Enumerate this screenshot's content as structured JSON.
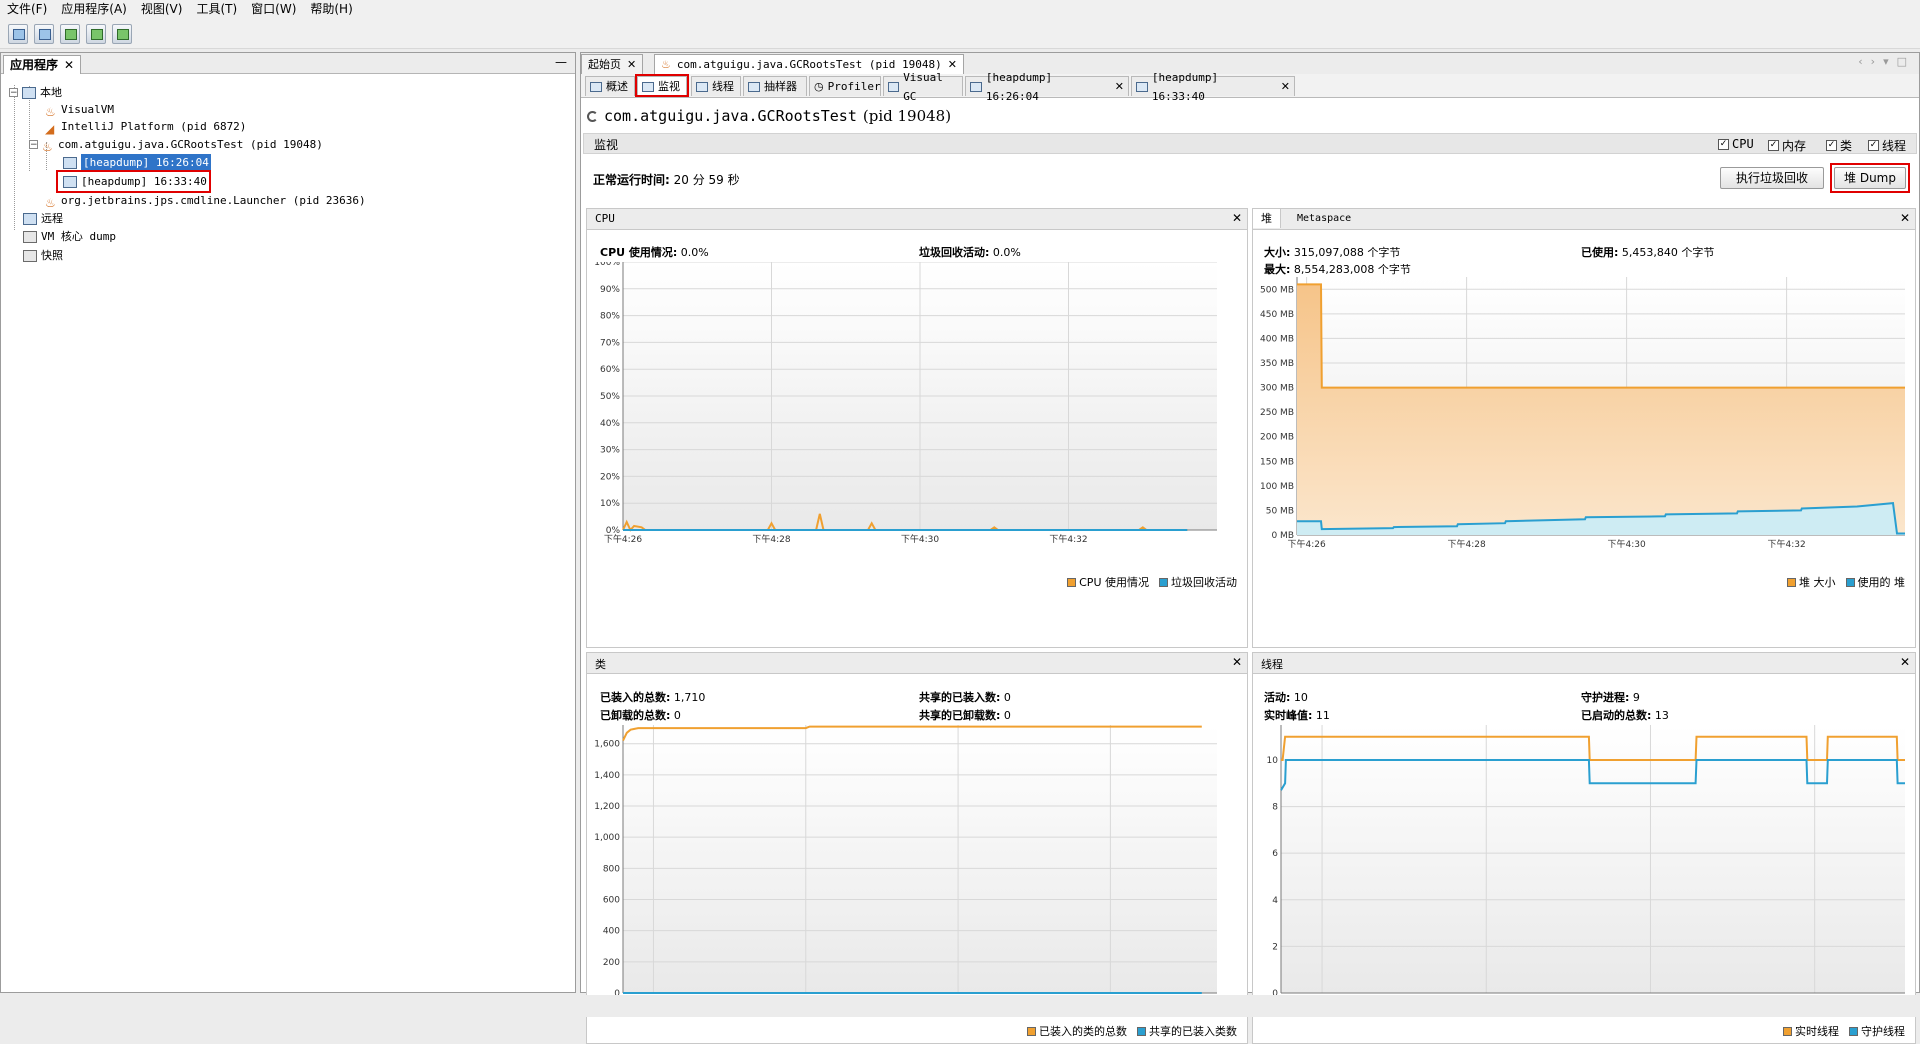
{
  "menu": [
    "文件(F)",
    "应用程序(A)",
    "视图(V)",
    "工具(T)",
    "窗口(W)",
    "帮助(H)"
  ],
  "left_panel": {
    "tab_label": "应用程序",
    "tree": {
      "local": "本地",
      "visualvm": "VisualVM",
      "intellij": "IntelliJ Platform (pid 6872)",
      "gcroots": "com.atguigu.java.GCRootsTest (pid 19048)",
      "heapdump1": "[heapdump] 16:26:04",
      "heapdump2": "[heapdump] 16:33:40",
      "launcher": "org.jetbrains.jps.cmdline.Launcher (pid 23636)",
      "remote": "远程",
      "coredump": "VM 核心 dump",
      "snapshot": "快照"
    }
  },
  "doc_tabs": {
    "start": "起始页",
    "app": "com.atguigu.java.GCRootsTest (pid 19048)"
  },
  "sub_tabs": {
    "overview": "概述",
    "monitor": "监视",
    "threads": "线程",
    "sampler": "抽样器",
    "profiler": "Profiler",
    "visualgc": "Visual GC",
    "hd1": "[heapdump] 16:26:04",
    "hd2": "[heapdump] 16:33:40"
  },
  "app_title": {
    "name": "com.atguigu.java.GCRootsTest",
    "pid": "(pid 19048)"
  },
  "monitor": {
    "label": "监视",
    "checks": [
      "CPU",
      "内存",
      "类",
      "线程"
    ],
    "uptime_label": "正常运行时间:",
    "uptime_value": "20 分 59 秒",
    "gc_button": "执行垃圾回收",
    "dump_button": "堆 Dump"
  },
  "cpu_panel": {
    "title": "CPU",
    "cpu_usage_label": "CPU 使用情况:",
    "cpu_usage_value": "0.0%",
    "gc_activity_label": "垃圾回收活动:",
    "gc_activity_value": "0.0%",
    "legend": [
      "CPU 使用情况",
      "垃圾回收活动"
    ]
  },
  "heap_panel": {
    "tabs": [
      "堆",
      "Metaspace"
    ],
    "size_label": "大小:",
    "size_value": "315,097,088 个字节",
    "max_label": "最大:",
    "max_value": "8,554,283,008 个字节",
    "used_label": "已使用:",
    "used_value": "5,453,840 个字节",
    "legend": [
      "堆 大小",
      "使用的 堆"
    ]
  },
  "class_panel": {
    "title": "类",
    "loaded_label": "已装入的总数:",
    "loaded_value": "1,710",
    "unloaded_label": "已卸载的总数:",
    "unloaded_value": "0",
    "shared_loaded_label": "共享的已装入数:",
    "shared_loaded_value": "0",
    "shared_unloaded_label": "共享的已卸载数:",
    "shared_unloaded_value": "0",
    "legend": [
      "已装入的类的总数",
      "共享的已装入类数"
    ]
  },
  "thread_panel": {
    "title": "线程",
    "live_label": "活动:",
    "live_value": "10",
    "peak_label": "实时峰值:",
    "peak_value": "11",
    "daemon_label": "守护进程:",
    "daemon_value": "9",
    "started_label": "已启动的总数:",
    "started_value": "13",
    "legend": [
      "实时线程",
      "守护线程"
    ]
  },
  "colors": {
    "orange": "#f0a030",
    "blue": "#2a9fd0",
    "selection": "#2f74c8",
    "highlight_box": "#e00000"
  },
  "chart_data": [
    {
      "type": "line",
      "name": "CPU",
      "x_ticks": [
        "下午4:26",
        "下午4:28",
        "下午4:30",
        "下午4:32"
      ],
      "y_ticks": [
        "0%",
        "10%",
        "20%",
        "30%",
        "40%",
        "50%",
        "60%",
        "70%",
        "80%",
        "90%",
        "100%"
      ],
      "ylim": [
        0,
        100
      ],
      "series": [
        {
          "name": "CPU 使用情况",
          "color": "#f0a030",
          "x": [
            0,
            0.05,
            0.1,
            0.15,
            0.25,
            0.3,
            1.95,
            2.0,
            2.05,
            2.6,
            2.65,
            2.7,
            3.3,
            3.35,
            3.4,
            4.95,
            5.0,
            5.05,
            6.95,
            7.0,
            7.05,
            7.6
          ],
          "y": [
            0,
            3,
            0,
            1.5,
            1,
            0,
            0,
            2.5,
            0,
            0,
            6,
            0,
            0,
            2.5,
            0,
            0,
            1,
            0,
            0,
            1,
            0,
            0
          ]
        },
        {
          "name": "垃圾回收活动",
          "color": "#2a9fd0",
          "x": [
            0,
            7.6
          ],
          "y": [
            0,
            0
          ]
        }
      ]
    },
    {
      "type": "area",
      "name": "堆",
      "x_ticks": [
        "下午4:26",
        "下午4:28",
        "下午4:30",
        "下午4:32"
      ],
      "y_ticks": [
        "0 MB",
        "50 MB",
        "100 MB",
        "150 MB",
        "200 MB",
        "250 MB",
        "300 MB",
        "350 MB",
        "400 MB",
        "450 MB",
        "500 MB"
      ],
      "ylim": [
        0,
        525
      ],
      "series": [
        {
          "name": "堆 大小",
          "color": "#f0a030",
          "x": [
            0,
            0.3,
            0.31,
            7.6
          ],
          "y": [
            510,
            510,
            300,
            300
          ]
        },
        {
          "name": "使用的 堆",
          "color": "#2a9fd0",
          "x": [
            0,
            0.3,
            0.31,
            1.2,
            1.21,
            2.0,
            2.01,
            2.6,
            2.61,
            3.6,
            3.61,
            4.6,
            4.61,
            5.5,
            5.51,
            6.3,
            6.31,
            7.0,
            7.45,
            7.5,
            7.6
          ],
          "y": [
            28,
            28,
            12,
            14,
            16,
            18,
            22,
            24,
            28,
            32,
            36,
            38,
            42,
            44,
            48,
            50,
            54,
            58,
            65,
            3,
            3
          ]
        }
      ]
    },
    {
      "type": "line",
      "name": "类",
      "x_ticks": [
        "下午4:26",
        "下午4:28",
        "下午4:30",
        "下午4:32"
      ],
      "y_ticks": [
        "0",
        "200",
        "400",
        "600",
        "800",
        "1,000",
        "1,200",
        "1,400",
        "1,600"
      ],
      "ylim": [
        0,
        1720
      ],
      "series": [
        {
          "name": "已装入的类的总数",
          "color": "#f0a030",
          "x": [
            0,
            0.05,
            0.1,
            0.2,
            2.4,
            2.45,
            7.6
          ],
          "y": [
            1620,
            1670,
            1690,
            1700,
            1700,
            1710,
            1710
          ]
        },
        {
          "name": "共享的已装入类数",
          "color": "#2a9fd0",
          "x": [
            0,
            7.6
          ],
          "y": [
            0,
            0
          ]
        }
      ]
    },
    {
      "type": "line",
      "name": "线程",
      "x_ticks": [
        "下午4:26",
        "下午4:28",
        "下午4:30",
        "下午4:32"
      ],
      "y_ticks": [
        "0",
        "2",
        "4",
        "6",
        "8",
        "10"
      ],
      "ylim": [
        0,
        11.5
      ],
      "series": [
        {
          "name": "实时线程",
          "color": "#f0a030",
          "x": [
            0,
            0.02,
            0.05,
            3.75,
            3.76,
            5.05,
            5.06,
            6.4,
            6.41,
            6.65,
            6.66,
            7.5,
            7.51,
            7.6
          ],
          "y": [
            10,
            10,
            11,
            11,
            10,
            10,
            11,
            11,
            10,
            10,
            11,
            11,
            10,
            10
          ]
        },
        {
          "name": "守护线程",
          "color": "#2a9fd0",
          "x": [
            0,
            0.05,
            0.06,
            3.75,
            3.76,
            5.05,
            5.06,
            6.4,
            6.41,
            6.65,
            6.66,
            7.5,
            7.51,
            7.6
          ],
          "y": [
            8.7,
            9,
            10,
            10,
            9,
            9,
            10,
            10,
            9,
            9,
            10,
            10,
            9,
            9
          ]
        }
      ]
    }
  ]
}
